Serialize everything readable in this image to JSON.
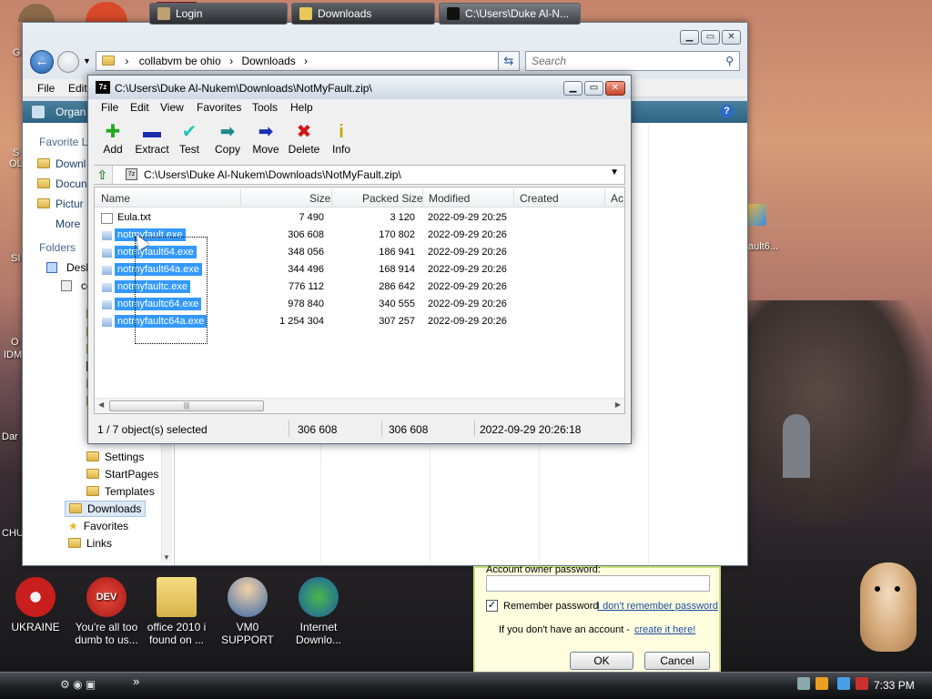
{
  "desktop": {
    "icons": [
      {
        "label": "UKRAINE"
      },
      {
        "label": "You're all too dumb to us..."
      },
      {
        "label": "office 2010 i found on ..."
      },
      {
        "label": "VM0 SUPPORT"
      },
      {
        "label": "Internet Downlo..."
      }
    ],
    "left_edge": [
      "G",
      "S",
      "OL",
      "SI",
      "O",
      "IDM",
      "Dar",
      "CHU"
    ],
    "right_icon": "ault6..."
  },
  "explorer": {
    "address": [
      "collabvm be ohio",
      "Downloads"
    ],
    "search_placeholder": "Search",
    "menus": [
      "File",
      "Edit"
    ],
    "organize": "Organ",
    "nav": {
      "favorite_links": "Favorite Li",
      "links": [
        "Downl",
        "Docun",
        "Pictur",
        "More"
      ],
      "folders": "Folders",
      "tree": [
        "Desk",
        "co"
      ],
      "tree_items": [
        "Settings",
        "StartPages",
        "Templates",
        "Downloads",
        "Favorites",
        "Links"
      ]
    }
  },
  "sevenzip": {
    "title": "C:\\Users\\Duke Al-Nukem\\Downloads\\NotMyFault.zip\\",
    "app_icon": "7z",
    "menus": [
      "File",
      "Edit",
      "View",
      "Favorites",
      "Tools",
      "Help"
    ],
    "toolbar": [
      {
        "label": "Add",
        "icon": "plus-icon",
        "glyph": "✚",
        "color": "#22aa22"
      },
      {
        "label": "Extract",
        "icon": "minus-icon",
        "glyph": "▬",
        "color": "#1a2faf"
      },
      {
        "label": "Test",
        "icon": "check-icon",
        "glyph": "✔",
        "color": "#27c0c0"
      },
      {
        "label": "Copy",
        "icon": "arrow-right-icon",
        "glyph": "➡",
        "color": "#1f8a8a"
      },
      {
        "label": "Move",
        "icon": "arrow-right-icon",
        "glyph": "➡",
        "color": "#1a2faf"
      },
      {
        "label": "Delete",
        "icon": "delete-x-icon",
        "glyph": "✖",
        "color": "#d01818"
      },
      {
        "label": "Info",
        "icon": "info-icon",
        "glyph": "i",
        "color": "#c9a800"
      }
    ],
    "path": "C:\\Users\\Duke Al-Nukem\\Downloads\\NotMyFault.zip\\",
    "columns": [
      "Name",
      "Size",
      "Packed Size",
      "Modified",
      "Created",
      "Ac"
    ],
    "files": [
      {
        "name": "Eula.txt",
        "size": "7 490",
        "packed": "3 120",
        "modified": "2022-09-29 20:25",
        "selected": false,
        "type": "txt"
      },
      {
        "name": "notmyfault.exe",
        "size": "306 608",
        "packed": "170 802",
        "modified": "2022-09-29 20:26",
        "selected": true,
        "type": "exe"
      },
      {
        "name": "notmyfault64.exe",
        "size": "348 056",
        "packed": "186 941",
        "modified": "2022-09-29 20:26",
        "selected": true,
        "type": "exe"
      },
      {
        "name": "notmyfault64a.exe",
        "size": "344 496",
        "packed": "168 914",
        "modified": "2022-09-29 20:26",
        "selected": true,
        "type": "exe"
      },
      {
        "name": "notmyfaultc.exe",
        "size": "776 112",
        "packed": "286 642",
        "modified": "2022-09-29 20:26",
        "selected": true,
        "type": "exe"
      },
      {
        "name": "notmyfaultc64.exe",
        "size": "978 840",
        "packed": "340 555",
        "modified": "2022-09-29 20:26",
        "selected": true,
        "type": "exe"
      },
      {
        "name": "notmyfaultc64a.exe",
        "size": "1 254 304",
        "packed": "307 257",
        "modified": "2022-09-29 20:26",
        "selected": true,
        "type": "exe"
      }
    ],
    "status": {
      "selection": "1 / 7 object(s) selected",
      "size": "306 608",
      "packed": "306 608",
      "modified": "2022-09-29 20:26:18"
    }
  },
  "login": {
    "pw_label": "Account owner password:",
    "remember": "Remember password",
    "forgot": "I don't remember password",
    "no_account": "If you don't have an account -",
    "create": "create it here!",
    "ok": "OK",
    "cancel": "Cancel"
  },
  "taskbar": {
    "buttons": [
      {
        "label": "Login",
        "color": "#c0a070"
      },
      {
        "label": "Downloads",
        "color": "#e8c85a"
      },
      {
        "label": "C:\\Users\\Duke Al-N...",
        "color": "#111111"
      }
    ],
    "clock": "7:33 PM",
    "quicklaunch": "»"
  }
}
